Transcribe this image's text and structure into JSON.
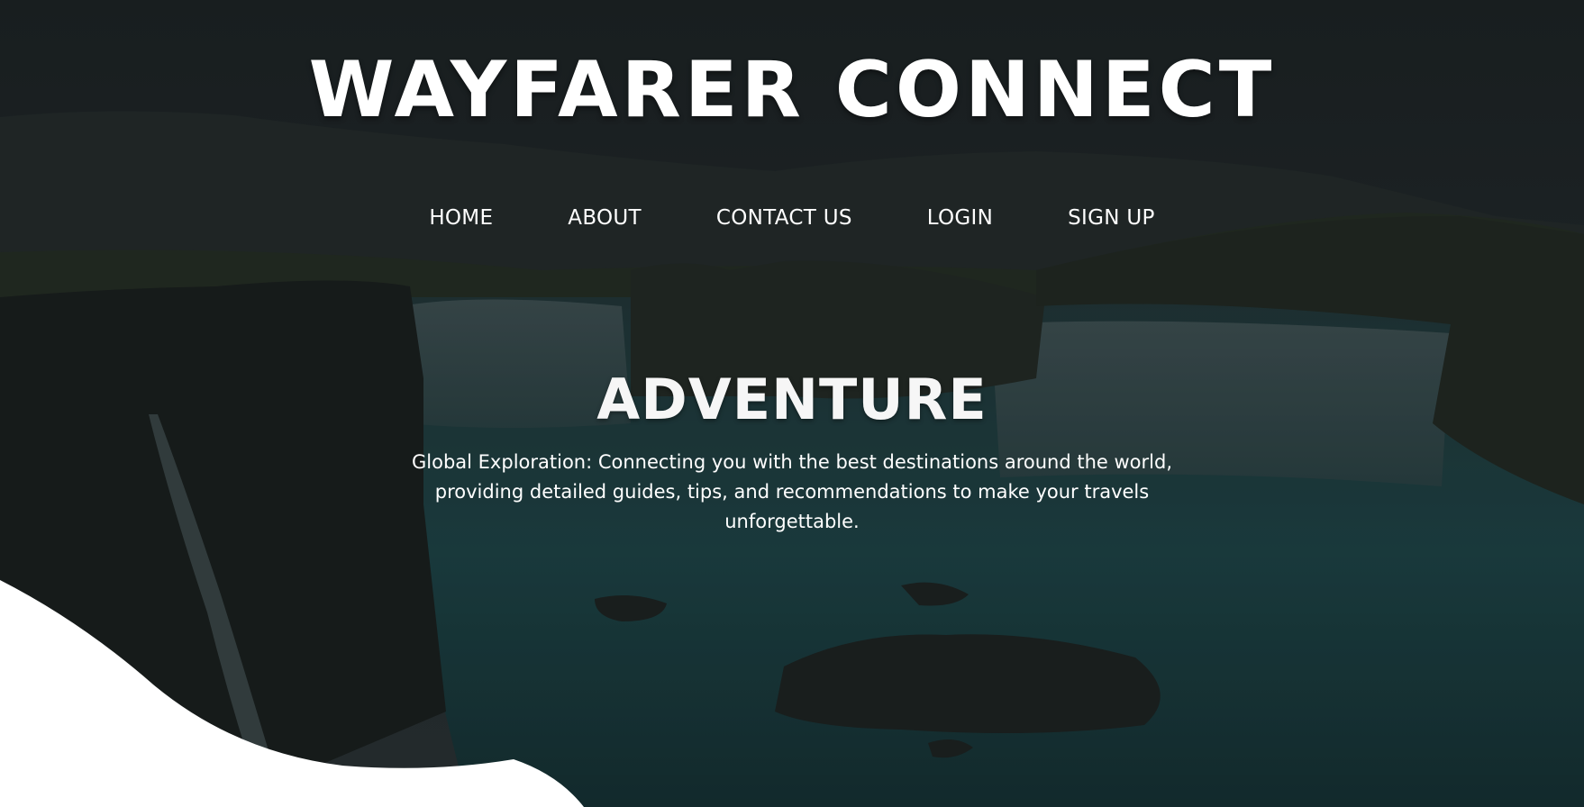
{
  "site": {
    "title": "WAYFARER CONNECT"
  },
  "nav": {
    "items": [
      {
        "label": "HOME"
      },
      {
        "label": "ABOUT"
      },
      {
        "label": "CONTACT US"
      },
      {
        "label": "LOGIN"
      },
      {
        "label": "SIGN UP"
      }
    ]
  },
  "hero": {
    "heading": "ADVENTURE",
    "description": "Global Exploration: Connecting you with the best destinations around the world, providing detailed guides, tips, and recommendations to make your travels unforgettable."
  },
  "colors": {
    "overlay": "#1c2628",
    "text": "#ffffff",
    "wave": "#ffffff",
    "water": "#1f4a4e"
  }
}
